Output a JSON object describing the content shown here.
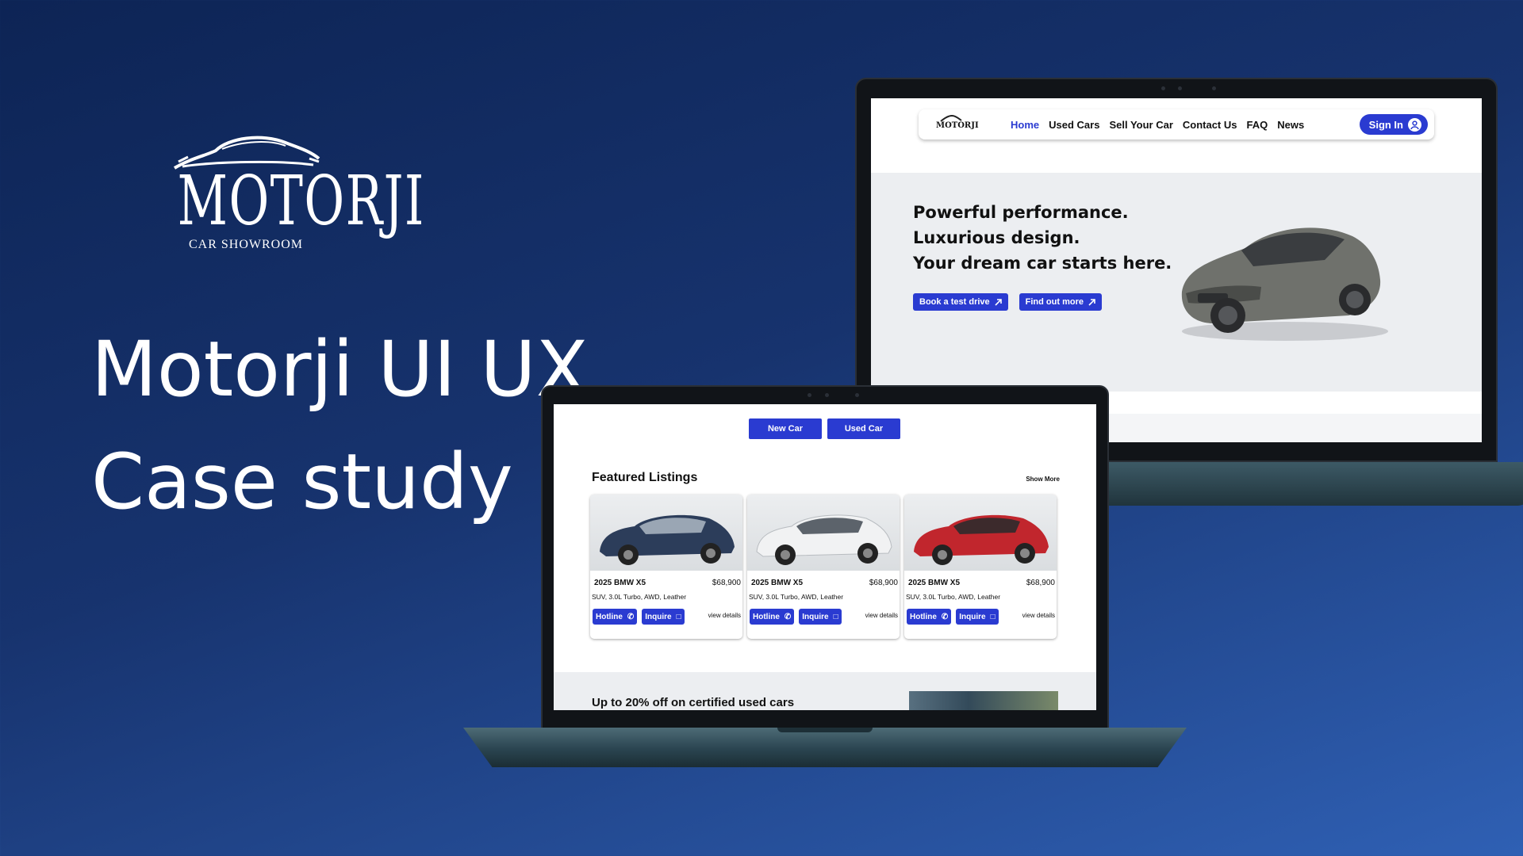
{
  "brand": {
    "name": "MOTORJI",
    "subtitle": "CAR SHOWROOM"
  },
  "headline": {
    "line1": "Motorji UI UX",
    "line2": "Case study"
  },
  "site": {
    "nav": {
      "logo_text": "MOTORJI",
      "links": [
        "Home",
        "Used Cars",
        "Sell Your Car",
        "Contact Us",
        "FAQ",
        "News"
      ],
      "active": "Home",
      "signin": "Sign In"
    },
    "hero": {
      "lines": [
        "Powerful performance.",
        "Luxurious design.",
        "Your dream car starts here."
      ],
      "btn_primary": "Book a test drive",
      "btn_secondary": "Find out more"
    },
    "tabs": {
      "new": "New Car",
      "used": "Used Car"
    },
    "featured": {
      "title": "Featured Listings",
      "show_more": "Show More",
      "cards": [
        {
          "title": "2025 BMW X5",
          "price": "$68,900",
          "spec": "SUV, 3.0L Turbo, AWD, Leather",
          "hotline": "Hotline",
          "inquire": "Inquire",
          "view": "view details",
          "color": "#2c3d5a"
        },
        {
          "title": "2025 BMW X5",
          "price": "$68,900",
          "spec": "SUV, 3.0L Turbo, AWD, Leather",
          "hotline": "Hotline",
          "inquire": "Inquire",
          "view": "view details",
          "color": "#e4e6e8"
        },
        {
          "title": "2025 BMW X5",
          "price": "$68,900",
          "spec": "SUV, 3.0L Turbo, AWD, Leather",
          "hotline": "Hotline",
          "inquire": "Inquire",
          "view": "view details",
          "color": "#c1262d"
        }
      ]
    },
    "promo": {
      "text": "Up to 20% off on certified used cars"
    }
  },
  "colors": {
    "accent": "#2a3bd1",
    "bg_dark": "#0d2455",
    "bg_light": "#2f60b4"
  }
}
